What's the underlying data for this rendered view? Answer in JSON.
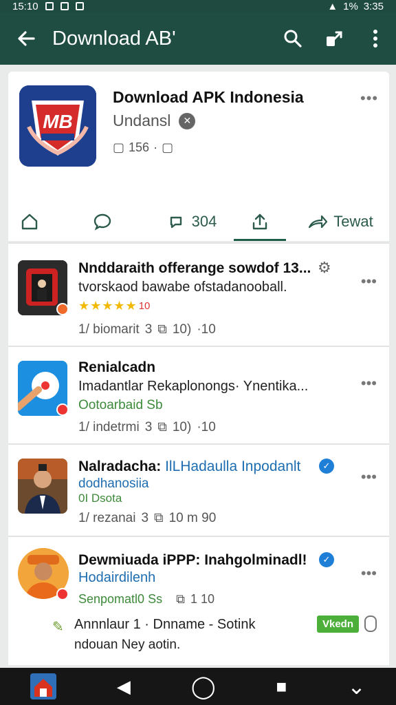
{
  "status_bar": {
    "time": "15:10",
    "battery": "1%",
    "clock_right": "3:35"
  },
  "app_bar": {
    "back_icon": "arrow-left-icon",
    "title": "Download AB'",
    "search_icon": "search-icon",
    "share_icon": "share-icon",
    "menu_icon": "more-vert-icon"
  },
  "channel": {
    "title": "Download APK Indonesia",
    "subtitle": "Undansl",
    "meta_count": "156",
    "logo_text": "MB",
    "actions": [
      {
        "icon": "home-icon",
        "label": ""
      },
      {
        "icon": "comment-icon",
        "label": ""
      },
      {
        "icon": "repost-icon",
        "label": "304"
      },
      {
        "icon": "upload-icon",
        "label": "",
        "active": true
      },
      {
        "icon": "forward-icon",
        "label": "Tewat"
      }
    ]
  },
  "items": [
    {
      "title": "Nnddaraith offerange sowdof 13...",
      "subtitle": "tvorskaod bawabe ofstadanooball.",
      "rating_text": "10",
      "meta": [
        "1/ biomarit",
        "3",
        "10)",
        "·10"
      ]
    },
    {
      "title": "Renialcadn",
      "subtitle": "Imadantlar Rekaplonongs· Ynentika...",
      "green": "Ootoarbaid Sb",
      "meta": [
        "1/ indetrmi",
        "3",
        "10)",
        "·10"
      ]
    },
    {
      "title": "Nalradacha: ",
      "title_blue": "IlLHadaulla Inpodanlt",
      "blue": "dodhanosiia",
      "green": "0I Dsota",
      "meta": [
        "1/ rezanai",
        "3",
        "10 m 90"
      ]
    },
    {
      "title": "Dewmiuada iPPP: Inahgolminadl!",
      "blue": "Hodairdilenh",
      "green": "Senpomatl0 Ss",
      "green_meta": "1 10",
      "footer_line1": "Annnlaur 1 · Dnname - Sotink",
      "footer_line2": "ndouan Ney aotin.",
      "pill": "Vkedn"
    }
  ],
  "nav_bar": {
    "back": "◀",
    "home": "◯",
    "recent": "■",
    "down": "⌄"
  },
  "colors": {
    "appbar": "#1f4d42",
    "accent": "#2c5a4c",
    "green": "#3d8a3a",
    "blue": "#1d6db0",
    "star": "#f2b900"
  }
}
